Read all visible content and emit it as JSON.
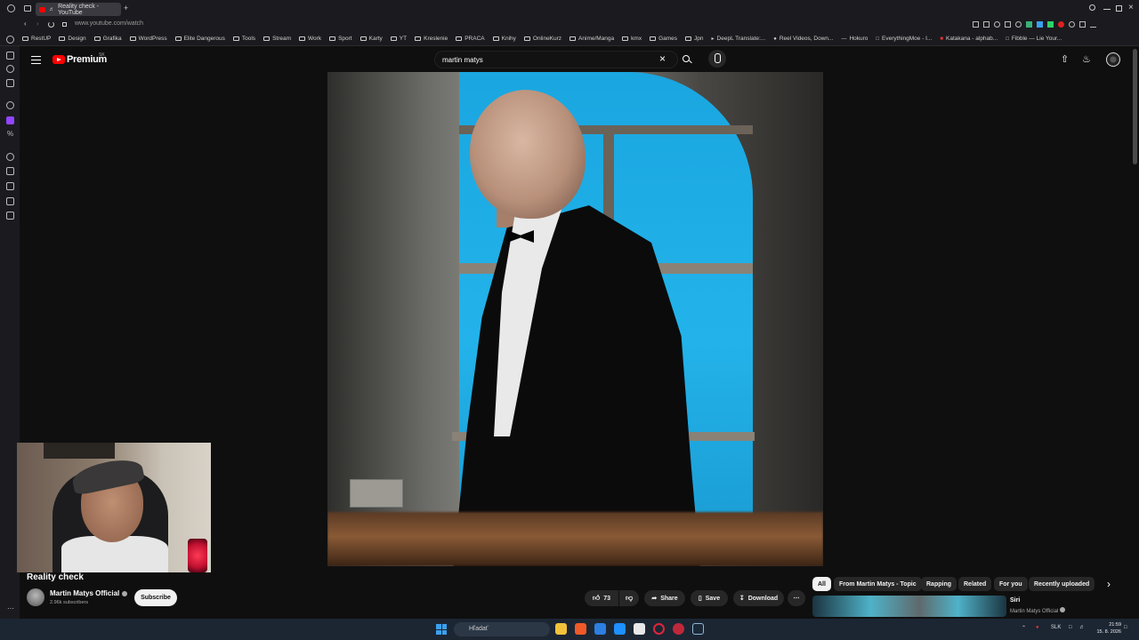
{
  "browser": {
    "tab_title": "Reality check - YouTube",
    "url": "www.youtube.com/watch",
    "bookmarks": [
      "RestUP",
      "Design",
      "Grafika",
      "WordPress",
      "Elite Dangerous",
      "Tools",
      "Stream",
      "Work",
      "Sport",
      "Karty",
      "YT",
      "Kreslenie",
      "PRACA",
      "Knihy",
      "OnlineKurz",
      "Anime/Manga",
      "kmx",
      "Games",
      "Jpn",
      "DeepL Translate:...",
      "Reel Videos, Down...",
      "Hokuro",
      "EverythingMoe - I...",
      "Katakana - alphab...",
      "Fibble — Lie Your..."
    ]
  },
  "youtube": {
    "brand": "Premium",
    "country": "SK",
    "search_value": "martin matys",
    "video_title": "Reality check",
    "channel_name": "Martin Matys Official",
    "subscribers": "2.96k subscribers",
    "subscribe_label": "Subscribe",
    "likes": "73",
    "share_label": "Share",
    "save_label": "Save",
    "download_label": "Download",
    "chips": [
      "All",
      "From Martin Matys - Topic",
      "Rapping",
      "Related",
      "For you",
      "Recently uploaded"
    ],
    "related": {
      "title": "Siri",
      "channel": "Martin Matys Official"
    }
  },
  "taskbar": {
    "search_placeholder": "Hľadať",
    "lang": "SLK",
    "time": "21:59",
    "date": "15. 8. 2026"
  },
  "colors": {
    "brand_red": "#ff0000",
    "bg": "#0f0f0f",
    "chip_bg": "#272727"
  }
}
